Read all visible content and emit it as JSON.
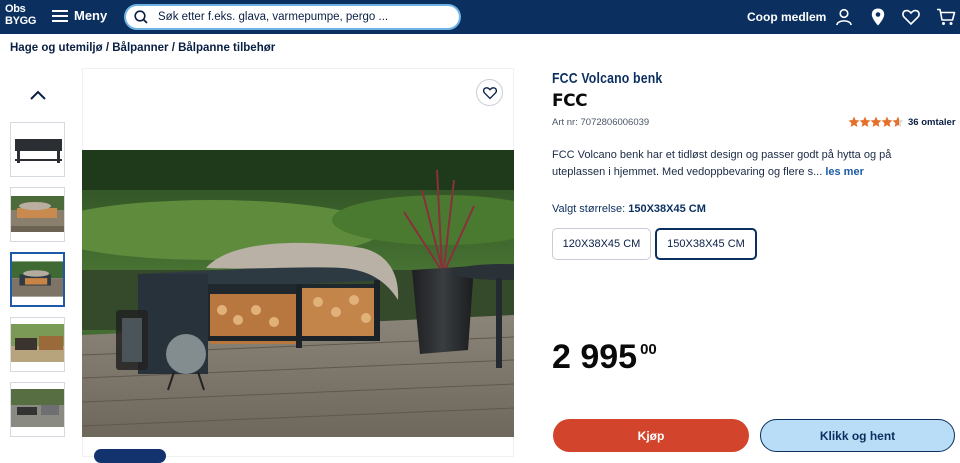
{
  "header": {
    "logo_line1": "Obs",
    "logo_line2": "BYGG",
    "menu_label": "Meny",
    "search_placeholder": "Søk etter f.eks. glava, varmepumpe, pergo ...",
    "member_label": "Coop medlem",
    "icons": [
      "menu-icon",
      "search-icon",
      "user-icon",
      "location-pin-icon",
      "heart-icon",
      "cart-icon"
    ]
  },
  "breadcrumb": {
    "items": [
      "Hage og utemiljø",
      "Bålpanner",
      "Bålpanne tilbehør"
    ],
    "separator": " / "
  },
  "gallery": {
    "thumbnail_count": 5,
    "active_index": 2
  },
  "product": {
    "title": "FCC Volcano benk",
    "brand": "FCC",
    "article_number": "Art nr: 7072806006039",
    "rating": 4.5,
    "reviews_label": "36 omtaler",
    "description": "FCC Volcano benk har et tidløst design og passer godt på hytta og på uteplassen i hjemmet. Med vedoppbevaring og flere s...",
    "read_more": "les mer",
    "size_label": "Valgt størrelse:",
    "selected_size": "150X38X45 CM",
    "sizes": [
      "120X38X45 CM",
      "150X38X45 CM"
    ],
    "price_main": "2 995",
    "price_cents": "00",
    "buy_label": "Kjøp",
    "pickup_label": "Klikk og hent"
  },
  "colors": {
    "header_bg": "#0b2f5f",
    "buy_button": "#d2442b",
    "pickup_button": "#b9ddf7",
    "star": "#e5702a"
  }
}
